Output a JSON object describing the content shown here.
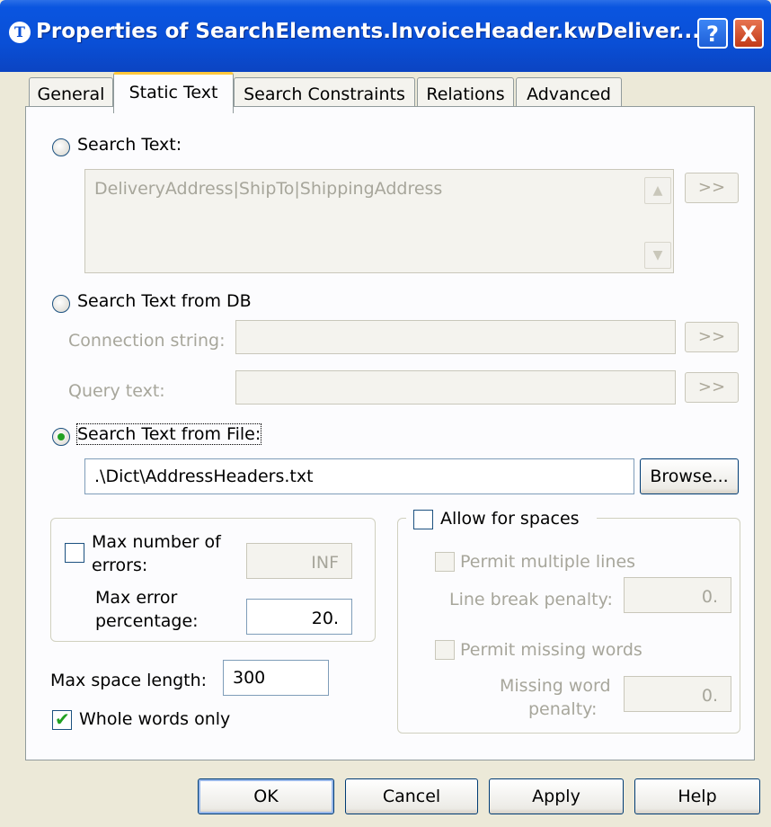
{
  "window": {
    "title": "Properties of SearchElements.InvoiceHeader.kwDeliver...",
    "help": "?",
    "close": "X"
  },
  "tabs": [
    "General",
    "Static Text",
    "Search Constraints",
    "Relations",
    "Advanced"
  ],
  "search_text": {
    "label": "Search Text:",
    "value": "DeliveryAddress|ShipTo|ShippingAddress",
    "more": ">>"
  },
  "search_db": {
    "label": "Search Text from DB",
    "connection_label": "Connection string:",
    "query_label": "Query text:",
    "more": ">>"
  },
  "search_file": {
    "label": "Search Text from File:",
    "path": ".\\Dict\\AddressHeaders.txt",
    "browse": "Browse..."
  },
  "errors": {
    "max_errors_label_1": "Max number of",
    "max_errors_label_2": "errors:",
    "max_errors_value": "INF",
    "max_pct_label_1": "Max error",
    "max_pct_label_2": "percentage:",
    "max_pct_value": "20."
  },
  "spaces": {
    "allow_label": "Allow for spaces",
    "multiline_label": "Permit multiple lines",
    "line_break_label": "Line break penalty:",
    "line_break_value": "0.",
    "missing_words_label": "Permit missing words",
    "missing_word_label_1": "Missing word",
    "missing_word_label_2": "penalty:",
    "missing_word_value": "0."
  },
  "max_space": {
    "label": "Max space length:",
    "value": "300"
  },
  "whole_words": {
    "label": "Whole words only",
    "checked": true
  },
  "buttons": {
    "ok": "OK",
    "cancel": "Cancel",
    "apply": "Apply",
    "help": "Help"
  }
}
